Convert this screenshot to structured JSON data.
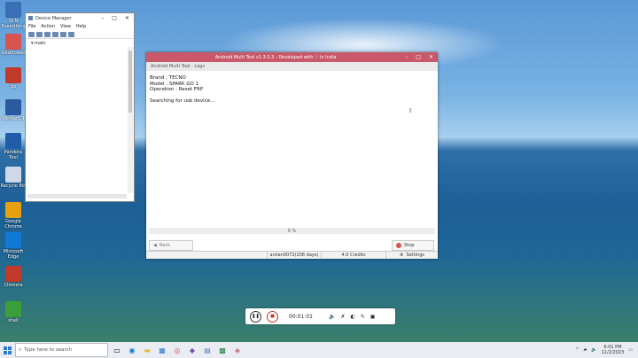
{
  "desktop_icons": [
    {
      "label": "SCN Everything",
      "color": "#3a6fb5"
    },
    {
      "label": "Deskfolder",
      "color": "#d9534f"
    },
    {
      "label": "Up",
      "color": "#c0392b"
    },
    {
      "label": "WinRar5.1",
      "color": "#2c5aa0"
    },
    {
      "label": "Pandora Tool",
      "color": "#1f5da8"
    },
    {
      "label": "Recycle Bin",
      "color": "#cfd8e6"
    },
    {
      "label": "Google Chrome",
      "color": "#e5a00d"
    },
    {
      "label": "Microsoft Edge",
      "color": "#0f7bd6"
    },
    {
      "label": "Chimera",
      "color": "#c0392b"
    },
    {
      "label": "shell",
      "color": "#3aa03a"
    }
  ],
  "device_manager": {
    "title": "Device Manager",
    "menu": [
      "File",
      "Action",
      "View",
      "Help"
    ],
    "tree_root": "main"
  },
  "amt": {
    "title": "Android Multi Tool v1.3.5.3 - Developed with ♡ in India",
    "subtitle": "Android Multi Tool - Logs",
    "log_lines": [
      "Brand : TECNO",
      "Model : SPARK GO 1",
      "Operation : Reset FRP",
      "",
      "Searching for usb device..."
    ],
    "progress": "0 %",
    "back": "Back",
    "stop": "Stop",
    "status": {
      "user": "arslan0072(206 days)",
      "credits": "4.0 Credits",
      "settings": "Settings"
    }
  },
  "recorder": {
    "time": "00:01:01"
  },
  "taskbar": {
    "search_placeholder": "Type here to search",
    "clock_time": "6:01 PM",
    "clock_date": "11/2/2023"
  }
}
